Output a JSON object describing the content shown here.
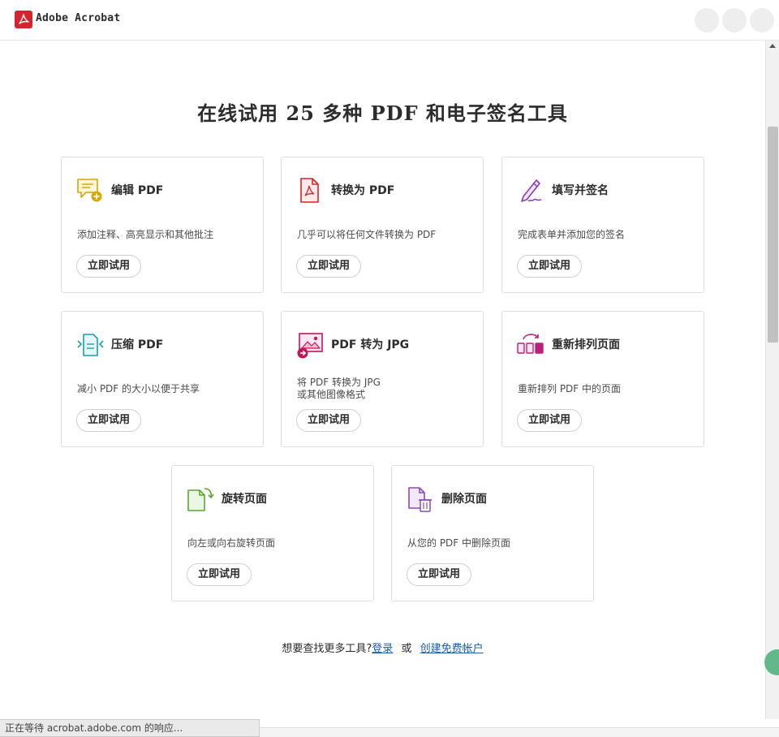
{
  "app": {
    "brand": "Adobe Acrobat"
  },
  "page": {
    "title": "在线试用 25 多种 PDF 和电子签名工具"
  },
  "cards": [
    {
      "title": "编辑 PDF",
      "desc": "添加注释、高亮显示和其他批注",
      "button": "立即试用",
      "icon": "edit-comment-icon"
    },
    {
      "title": "转换为 PDF",
      "desc": "几乎可以将任何文件转换为 PDF",
      "button": "立即试用",
      "icon": "pdf-file-icon"
    },
    {
      "title": "填写并签名",
      "desc": "完成表单并添加您的签名",
      "button": "立即试用",
      "icon": "sign-pen-icon"
    },
    {
      "title": "压缩 PDF",
      "desc": "减小 PDF 的大小以便于共享",
      "button": "立即试用",
      "icon": "compress-icon"
    },
    {
      "title": "PDF 转为 JPG",
      "desc": "将 PDF 转换为 JPG\n或其他图像格式",
      "button": "立即试用",
      "icon": "image-convert-icon"
    },
    {
      "title": "重新排列页面",
      "desc": "重新排列 PDF 中的页面",
      "button": "立即试用",
      "icon": "reorder-pages-icon"
    },
    {
      "title": "旋转页面",
      "desc": "向左或向右旋转页面",
      "button": "立即试用",
      "icon": "rotate-page-icon"
    },
    {
      "title": "删除页面",
      "desc": "从您的 PDF 中删除页面",
      "button": "立即试用",
      "icon": "delete-page-icon"
    }
  ],
  "footer": {
    "prompt": "想要查找更多工具?",
    "login": "登录",
    "or": "或",
    "signup": "创建免费帐户"
  },
  "status": {
    "text": "正在等待 acrobat.adobe.com 的响应..."
  },
  "colors": {
    "acrobat_red": "#d7242c",
    "link": "#1a5fa8",
    "accent_green": "#5fb98a"
  }
}
